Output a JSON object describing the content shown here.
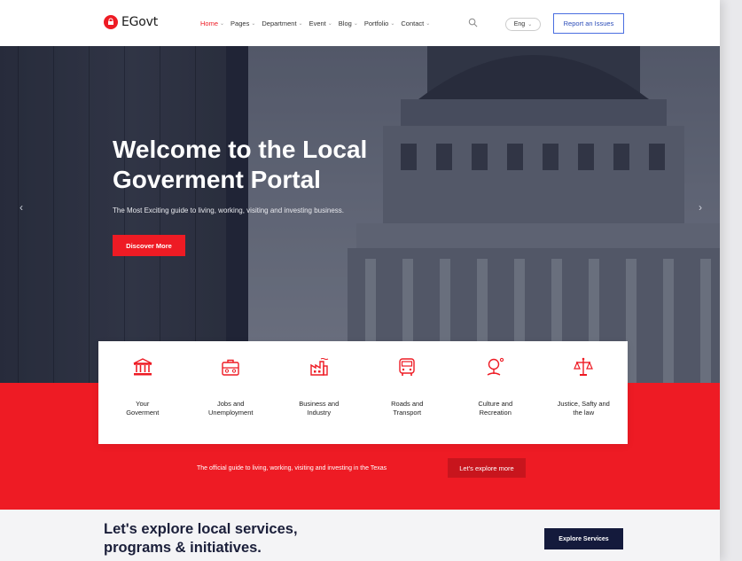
{
  "brand": {
    "name": "EGovt",
    "accent": "#ee1b24",
    "navy": "#141a3c"
  },
  "nav": [
    {
      "label": "Home",
      "active": true
    },
    {
      "label": "Pages",
      "active": false
    },
    {
      "label": "Department",
      "active": false
    },
    {
      "label": "Event",
      "active": false
    },
    {
      "label": "Blog",
      "active": false
    },
    {
      "label": "Portfolio",
      "active": false
    },
    {
      "label": "Contact",
      "active": false
    }
  ],
  "lang": "Eng",
  "report_button": "Report an Issues",
  "hero": {
    "title_line1": "Welcome to the Local",
    "title_line2": "Goverment Portal",
    "subtitle": "The Most Exciting guide to living, working, visiting and investing business.",
    "button": "Discover More"
  },
  "services": [
    {
      "icon": "government-icon",
      "line1": "Your",
      "line2": "Goverment"
    },
    {
      "icon": "briefcase-icon",
      "line1": "Jobs and",
      "line2": "Unemployment"
    },
    {
      "icon": "factory-icon",
      "line1": "Business and",
      "line2": "Industry"
    },
    {
      "icon": "bus-icon",
      "line1": "Roads and",
      "line2": "Transport"
    },
    {
      "icon": "culture-icon",
      "line1": "Culture and",
      "line2": "Recreation"
    },
    {
      "icon": "justice-scale-icon",
      "line1": "Justice, Safty and",
      "line2": "the law"
    }
  ],
  "band": {
    "text": "The official guide to living, working, visiting and investing in the Texas",
    "button": "Let's explore more"
  },
  "bottom": {
    "title_line1": "Let's explore local services,",
    "title_line2": "programs & initiatives.",
    "button": "Explore Services"
  }
}
